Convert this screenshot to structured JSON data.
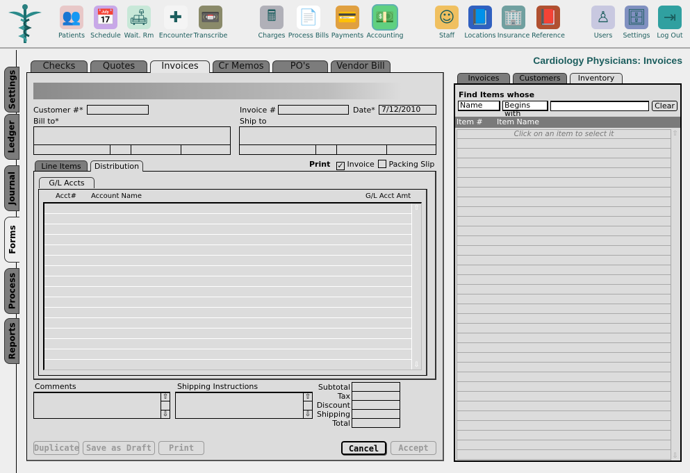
{
  "toolbar": {
    "items": [
      {
        "label": "Patients",
        "icon": "patients-icon",
        "glyph": "👥"
      },
      {
        "label": "Schedule",
        "icon": "calendar-icon",
        "glyph": "📅"
      },
      {
        "label": "Wait. Rm",
        "icon": "waiting-room-icon",
        "glyph": "🛋"
      },
      {
        "label": "Encounter",
        "icon": "medical-kit-icon",
        "glyph": "✚"
      },
      {
        "label": "Transcribe",
        "icon": "cassette-icon",
        "glyph": "📼"
      },
      {
        "label": "Charges",
        "icon": "calculator-icon",
        "glyph": "🖩"
      },
      {
        "label": "Process Bills",
        "icon": "paper-stack-icon",
        "glyph": "📄"
      },
      {
        "label": "Payments",
        "icon": "credit-card-icon",
        "glyph": "💳"
      },
      {
        "label": "Accounting",
        "icon": "money-icon",
        "glyph": "💵"
      },
      {
        "label": "Staff",
        "icon": "nurse-icon",
        "glyph": "☺"
      },
      {
        "label": "Locations",
        "icon": "address-book-icon",
        "glyph": "📘"
      },
      {
        "label": "Insurance",
        "icon": "buildings-icon",
        "glyph": "🏢"
      },
      {
        "label": "Reference",
        "icon": "book-icon",
        "glyph": "📕"
      },
      {
        "label": "Users",
        "icon": "user-icon",
        "glyph": "♙"
      },
      {
        "label": "Settings",
        "icon": "file-cabinet-icon",
        "glyph": "🗄"
      },
      {
        "label": "Log Out",
        "icon": "door-exit-icon",
        "glyph": "⇥"
      }
    ],
    "accent": "#1b5d5d"
  },
  "side_tabs": [
    "Settings",
    "Ledger",
    "Journal",
    "Forms",
    "Process",
    "Reports"
  ],
  "side_active": "Forms",
  "form_tabs": [
    "Checks",
    "Quotes",
    "Invoices",
    "Cr Memos",
    "PO's",
    "Vendor Bill"
  ],
  "form_active": "Invoices",
  "header": {
    "customer_label": "Customer #*",
    "customer_value": "",
    "invoice_label": "Invoice #",
    "invoice_value": "",
    "date_label": "Date*",
    "date_value": "7/12/2010",
    "bill_to_label": "Bill to*",
    "ship_to_label": "Ship to"
  },
  "sub_tabs": [
    "Line Items",
    "Distribution"
  ],
  "sub_active": "Distribution",
  "print": {
    "label": "Print",
    "invoice_label": "Invoice",
    "invoice_checked": true,
    "packing_label": "Packing Slip",
    "packing_checked": false
  },
  "gl": {
    "tab": "G/L Accts",
    "columns": [
      "Acct#",
      "Account Name",
      "G/L Acct Amt"
    ],
    "rows": []
  },
  "bottom": {
    "comments_label": "Comments",
    "shipping_label": "Shipping Instructions",
    "totals": [
      "Subtotal",
      "Tax",
      "Discount",
      "Shipping",
      "Total"
    ]
  },
  "buttons": {
    "duplicate": "Duplicate",
    "save_draft": "Save as Draft",
    "print": "Print",
    "cancel": "Cancel",
    "accept": "Accept"
  },
  "right": {
    "title": "Cardiology Physicians:  Invoices",
    "tabs": [
      "Invoices",
      "Customers",
      "Inventory"
    ],
    "active": "Inventory",
    "find_label": "Find Items whose",
    "field_select": "Name",
    "op_select": "Begins with",
    "search_value": "",
    "clear_label": "Clear",
    "columns": [
      "Item #",
      "Item Name"
    ],
    "hint": "Click on an item to select it"
  }
}
